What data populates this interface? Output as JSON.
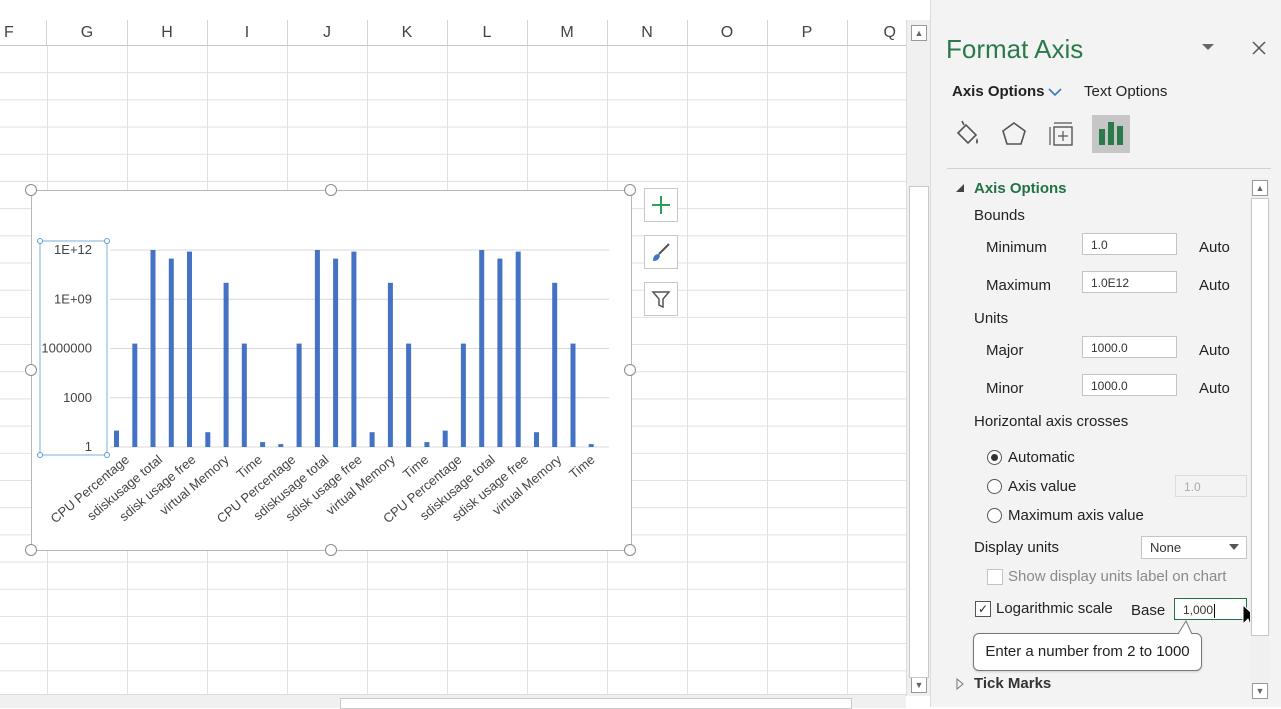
{
  "spreadsheet": {
    "columns": [
      "F",
      "G",
      "H",
      "I",
      "J",
      "K",
      "L",
      "M",
      "N",
      "O",
      "P",
      "Q"
    ]
  },
  "chart": {
    "chart_data": {
      "type": "bar",
      "y_scale": "log",
      "log_base": 1000,
      "ylim": [
        1,
        1000000000000
      ],
      "y_tick_labels": [
        "1E+12",
        "1E+09",
        "1000000",
        "1000",
        "1"
      ],
      "categories": [
        "CPU Percentage",
        "sdiskusage total",
        "sdisk usage free",
        "virtual Memory",
        "Time",
        "CPU Percentage",
        "sdiskusage total",
        "sdisk usage free",
        "virtual Memory",
        "Time",
        "CPU Percentage",
        "sdiskusage total",
        "sdisk usage free",
        "virtual Memory",
        "Time"
      ],
      "series": [
        {
          "values": [
            10,
            2000000,
            1000000000000,
            300000000000,
            800000000000,
            8,
            10000000000,
            2000000,
            2,
            1.5,
            2000000,
            1000000000000,
            300000000000,
            800000000000,
            8,
            10000000000,
            2000000,
            2,
            10,
            2000000,
            1000000000000,
            300000000000,
            800000000000,
            8,
            10000000000,
            2000000,
            1.5
          ]
        }
      ],
      "grid": true,
      "legend": "none"
    }
  },
  "chart_buttons": {
    "add_icon": "plus-icon",
    "style_icon": "brush-icon",
    "filter_icon": "filter-icon"
  },
  "pane": {
    "title": "Format Axis",
    "tab_axis_options": "Axis Options",
    "tab_text_options": "Text Options",
    "section_axis_options": "Axis Options",
    "bounds_label": "Bounds",
    "minimum_label": "Minimum",
    "minimum_value": "1.0",
    "maximum_label": "Maximum",
    "maximum_value": "1.0E12",
    "auto_label": "Auto",
    "units_label": "Units",
    "major_label": "Major",
    "major_value": "1000.0",
    "minor_label": "Minor",
    "minor_value": "1000.0",
    "horizontal_axis_crosses": "Horizontal axis crosses",
    "automatic_label": "Automatic",
    "axis_value_label": "Axis value",
    "axis_value_input": "1.0",
    "max_axis_value_label": "Maximum axis value",
    "display_units_label": "Display units",
    "display_units_value": "None",
    "show_display_units_label": "Show display units label on chart",
    "log_scale_label": "Logarithmic scale",
    "base_label": "Base",
    "base_value": "1,000",
    "tooltip": "Enter a number from 2 to 1000",
    "tick_marks_label": "Tick Marks"
  }
}
